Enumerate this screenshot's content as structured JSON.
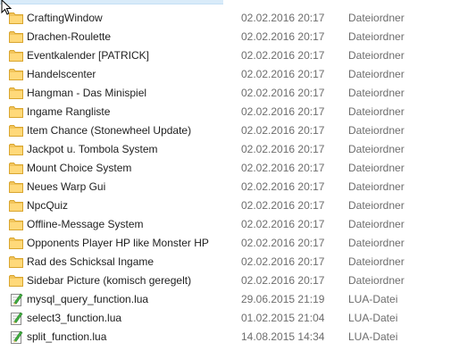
{
  "files": [
    {
      "name": "CraftingWindow",
      "date": "02.02.2016 20:17",
      "type": "Dateiordner",
      "icon": "folder-icon"
    },
    {
      "name": "Drachen-Roulette",
      "date": "02.02.2016 20:17",
      "type": "Dateiordner",
      "icon": "folder-icon"
    },
    {
      "name": "Eventkalender [PATRICK]",
      "date": "02.02.2016 20:17",
      "type": "Dateiordner",
      "icon": "folder-icon"
    },
    {
      "name": "Handelscenter",
      "date": "02.02.2016 20:17",
      "type": "Dateiordner",
      "icon": "folder-icon"
    },
    {
      "name": "Hangman - Das Minispiel",
      "date": "02.02.2016 20:17",
      "type": "Dateiordner",
      "icon": "folder-icon"
    },
    {
      "name": "Ingame Rangliste",
      "date": "02.02.2016 20:17",
      "type": "Dateiordner",
      "icon": "folder-icon"
    },
    {
      "name": "Item Chance (Stonewheel Update)",
      "date": "02.02.2016 20:17",
      "type": "Dateiordner",
      "icon": "folder-icon"
    },
    {
      "name": "Jackpot u. Tombola System",
      "date": "02.02.2016 20:17",
      "type": "Dateiordner",
      "icon": "folder-icon"
    },
    {
      "name": "Mount Choice System",
      "date": "02.02.2016 20:17",
      "type": "Dateiordner",
      "icon": "folder-icon"
    },
    {
      "name": "Neues Warp Gui",
      "date": "02.02.2016 20:17",
      "type": "Dateiordner",
      "icon": "folder-icon"
    },
    {
      "name": "NpcQuiz",
      "date": "02.02.2016 20:17",
      "type": "Dateiordner",
      "icon": "folder-icon"
    },
    {
      "name": "Offline-Message System",
      "date": "02.02.2016 20:17",
      "type": "Dateiordner",
      "icon": "folder-icon"
    },
    {
      "name": "Opponents Player HP like Monster HP",
      "date": "02.02.2016 20:17",
      "type": "Dateiordner",
      "icon": "folder-icon"
    },
    {
      "name": "Rad des Schicksal Ingame",
      "date": "02.02.2016 20:17",
      "type": "Dateiordner",
      "icon": "folder-icon"
    },
    {
      "name": "Sidebar Picture (komisch geregelt)",
      "date": "02.02.2016 20:17",
      "type": "Dateiordner",
      "icon": "folder-icon"
    },
    {
      "name": "mysql_query_function.lua",
      "date": "29.06.2015 21:19",
      "type": "LUA-Datei",
      "icon": "lua-file-icon"
    },
    {
      "name": "select3_function.lua",
      "date": "01.02.2015 21:04",
      "type": "LUA-Datei",
      "icon": "lua-file-icon"
    },
    {
      "name": "split_function.lua",
      "date": "14.08.2015 14:34",
      "type": "LUA-Datei",
      "icon": "lua-file-icon"
    }
  ]
}
